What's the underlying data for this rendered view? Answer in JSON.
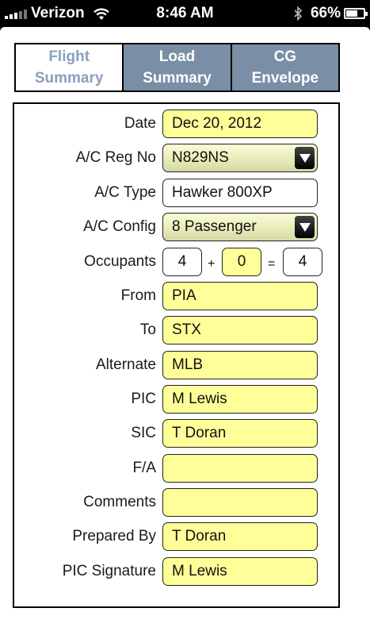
{
  "status_bar": {
    "carrier": "Verizon",
    "time": "8:46 AM",
    "battery": "66%",
    "battery_level": 0.66
  },
  "tabs": [
    {
      "label": "Flight\nSummary",
      "active": true
    },
    {
      "label": "Load\nSummary",
      "active": false
    },
    {
      "label": "CG\nEnvelope",
      "active": false
    }
  ],
  "form": {
    "date": {
      "label": "Date",
      "value": "Dec 20, 2012"
    },
    "ac_reg_no": {
      "label": "A/C Reg No",
      "value": "N829NS"
    },
    "ac_type": {
      "label": "A/C Type",
      "value": "Hawker 800XP"
    },
    "ac_config": {
      "label": "A/C Config",
      "value": "8 Passenger"
    },
    "occupants": {
      "label": "Occupants",
      "first": "4",
      "plus": "+",
      "second": "0",
      "equals": "=",
      "total": "4"
    },
    "from": {
      "label": "From",
      "value": "PIA"
    },
    "to": {
      "label": "To",
      "value": "STX"
    },
    "alternate": {
      "label": "Alternate",
      "value": "MLB"
    },
    "pic": {
      "label": "PIC",
      "value": "M Lewis"
    },
    "sic": {
      "label": "SIC",
      "value": "T Doran"
    },
    "fa": {
      "label": "F/A",
      "value": ""
    },
    "comments": {
      "label": "Comments",
      "value": ""
    },
    "prepared_by": {
      "label": "Prepared By",
      "value": "T Doran"
    },
    "pic_signature": {
      "label": "PIC Signature",
      "value": "M Lewis"
    }
  },
  "colors": {
    "field_yellow": "#ffff99",
    "tab_inactive": "#7a8ea6",
    "tab_active_text": "#8ba0bc"
  },
  "icons": {
    "signal": "signal-bars-icon",
    "wifi": "wifi-icon",
    "bluetooth": "bluetooth-icon",
    "battery": "battery-icon",
    "dropdown": "dropdown-arrow-icon"
  }
}
